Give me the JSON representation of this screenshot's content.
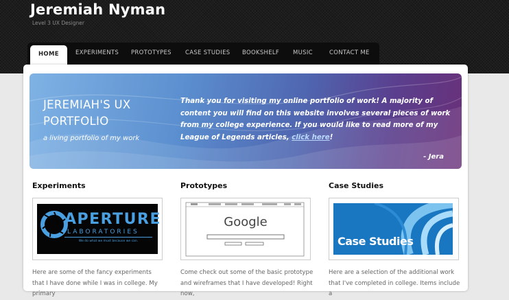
{
  "header": {
    "title": "Jeremiah Nyman",
    "subtitle": "Level 3 UX Designer"
  },
  "nav": {
    "items": [
      "HOME",
      "EXPERIMENTS",
      "PROTOTYPES",
      "CASE STUDIES",
      "BOOKSHELF",
      "MUSIC",
      "CONTACT ME"
    ],
    "active": "HOME"
  },
  "banner": {
    "title": "JEREMIAH'S UX PORTFOLIO",
    "subtitle": "a living portfolio of my work",
    "text_before": "Thank you for visiting my online portfolio of work! A majority of content you will find on this website involves several pieces of work from my college experience. If you would like to read more of my League of Legends articles, ",
    "link": "click here",
    "text_after": "!",
    "signature": "- Jera"
  },
  "columns": [
    {
      "title": "Experiments",
      "logo_main": "APERTURE",
      "logo_sub": "LABORATORIES",
      "logo_tagline": "We do what we must because we can.",
      "text": "Here are some of the fancy experiments that I have done while I was in college. My primary"
    },
    {
      "title": "Prototypes",
      "logo_main": "Google",
      "text": "Come check out some of the basic prototype and wireframes that I have developed! Right now,"
    },
    {
      "title": "Case Studies",
      "logo_main": "Case Studies",
      "text": "Here are a selection of the additional work that I've completed in college. Items include a"
    }
  ],
  "colors": {
    "accent": "#4a9fe0",
    "header_bg": "#1c1c1c",
    "nav_bg": "#0d0d0d",
    "case_blue": "#1976c0"
  }
}
